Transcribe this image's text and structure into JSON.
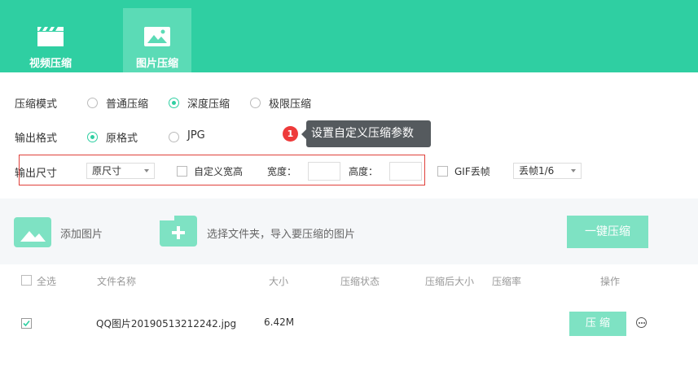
{
  "tabs": [
    {
      "label": "视频压缩",
      "icon": "video-icon",
      "active": false
    },
    {
      "label": "图片压缩",
      "icon": "image-icon",
      "active": true
    }
  ],
  "compress_mode": {
    "label": "压缩模式",
    "options": [
      "普通压缩",
      "深度压缩",
      "极限压缩"
    ],
    "selected": "深度压缩"
  },
  "output_format": {
    "label": "输出格式",
    "options": [
      "原格式",
      "JPG"
    ],
    "selected": "原格式"
  },
  "output_size": {
    "label": "输出尺寸",
    "select_value": "原尺寸",
    "custom_label": "自定义宽高",
    "width_label": "宽度：",
    "height_label": "高度：",
    "width_value": "",
    "height_value": ""
  },
  "gif": {
    "label": "GIF丢帧",
    "select_value": "丢帧1/6"
  },
  "tooltip": {
    "badge": "1",
    "text": "设置自定义压缩参数"
  },
  "actions": {
    "add_image": "添加图片",
    "select_folder": "选择文件夹，导入要压缩的图片",
    "one_key": "一键压缩"
  },
  "table": {
    "select_all": "全选",
    "columns": [
      "文件名称",
      "大小",
      "压缩状态",
      "压缩后大小",
      "压缩率",
      "操作"
    ],
    "rows": [
      {
        "checked": true,
        "name": "QQ图片20190513212242.jpg",
        "size": "6.42M",
        "status": "",
        "after": "",
        "rate": "",
        "action": "压 缩"
      }
    ]
  },
  "colors": {
    "accent": "#2fcfa2",
    "accent_light": "#7ee2c3",
    "error": "#e0403a"
  }
}
